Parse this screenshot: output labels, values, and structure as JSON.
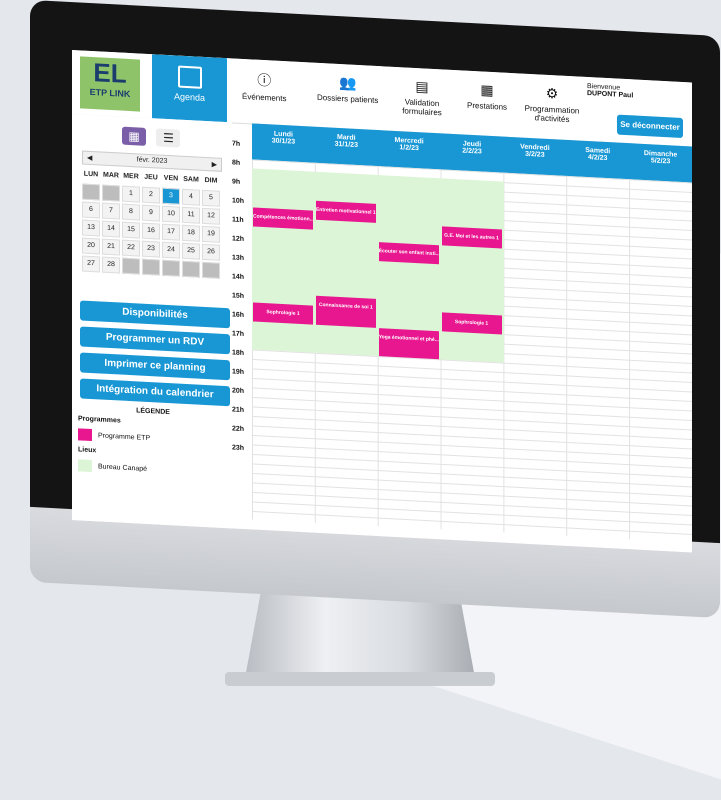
{
  "header": {
    "logo_main": "EL",
    "logo_sub": "ETP LINK",
    "nav": [
      {
        "label": "Agenda",
        "icon": "calendar-icon"
      },
      {
        "label": "Événements",
        "icon": "alert-icon"
      },
      {
        "label": "Dossiers patients",
        "icon": "users-icon"
      },
      {
        "label": "Validation formulaires",
        "icon": "form-icon"
      },
      {
        "label": "Prestations",
        "icon": "presentation-icon"
      },
      {
        "label": "Programmation d'activités",
        "icon": "activities-icon"
      }
    ],
    "welcome_label": "Bienvenue",
    "user_name": "DUPONT Paul",
    "logout_label": "Se déconnecter"
  },
  "sidebar": {
    "calendar": {
      "month_label": "févr. 2023",
      "weekdays": [
        "LUN",
        "MAR",
        "MER",
        "JEU",
        "VEN",
        "SAM",
        "DIM"
      ],
      "days": [
        "",
        "",
        "1",
        "2",
        "3",
        "4",
        "5",
        "6",
        "7",
        "8",
        "9",
        "10",
        "11",
        "12",
        "13",
        "14",
        "15",
        "16",
        "17",
        "18",
        "19",
        "20",
        "21",
        "22",
        "23",
        "24",
        "25",
        "26",
        "27",
        "28",
        "",
        "",
        "",
        "",
        ""
      ],
      "selected_day": "3"
    },
    "buttons": [
      "Disponibilités",
      "Programmer un RDV",
      "Imprimer ce planning",
      "Intégration du calendrier"
    ],
    "legend": {
      "title": "LÉGENDE",
      "programmes_title": "Programmes",
      "programme_item": "Programme ETP",
      "programme_color": "#e8178f",
      "lieux_title": "Lieux",
      "lieu_item": "Bureau Canapé",
      "lieu_color": "#dcf5d6"
    }
  },
  "planner": {
    "days": [
      {
        "name": "Lundi",
        "date": "30/1/23"
      },
      {
        "name": "Mardi",
        "date": "31/1/23"
      },
      {
        "name": "Mercredi",
        "date": "1/2/23"
      },
      {
        "name": "Jeudi",
        "date": "2/2/23"
      },
      {
        "name": "Vendredi",
        "date": "3/2/23"
      },
      {
        "name": "Samedi",
        "date": "4/2/23"
      },
      {
        "name": "Dimanche",
        "date": "5/2/23"
      }
    ],
    "hours": [
      "7h",
      "8h",
      "9h",
      "10h",
      "11h",
      "12h",
      "13h",
      "14h",
      "15h",
      "16h",
      "17h",
      "18h",
      "19h",
      "20h",
      "21h",
      "22h",
      "23h"
    ],
    "events": [
      {
        "title": "Compétences émotionn...",
        "day": 0,
        "start": "10h",
        "end": "11h"
      },
      {
        "title": "Entretien motivationnel 1",
        "day": 1,
        "start": "9h30",
        "end": "10h30"
      },
      {
        "title": "Écouter son enfant insti...",
        "day": 2,
        "start": "11h30",
        "end": "12h30"
      },
      {
        "title": "G.E. Moi et les autres 1",
        "day": 3,
        "start": "10h30",
        "end": "11h30"
      },
      {
        "title": "Sophrologie 1",
        "day": 0,
        "start": "15h",
        "end": "16h"
      },
      {
        "title": "Connaissance de soi 1",
        "day": 1,
        "start": "14h30",
        "end": "16h"
      },
      {
        "title": "Sophrologie 1",
        "day": 3,
        "start": "15h",
        "end": "16h"
      },
      {
        "title": "Yoga émotionnel et phé...",
        "day": 2,
        "start": "16h",
        "end": "17h30"
      }
    ]
  }
}
